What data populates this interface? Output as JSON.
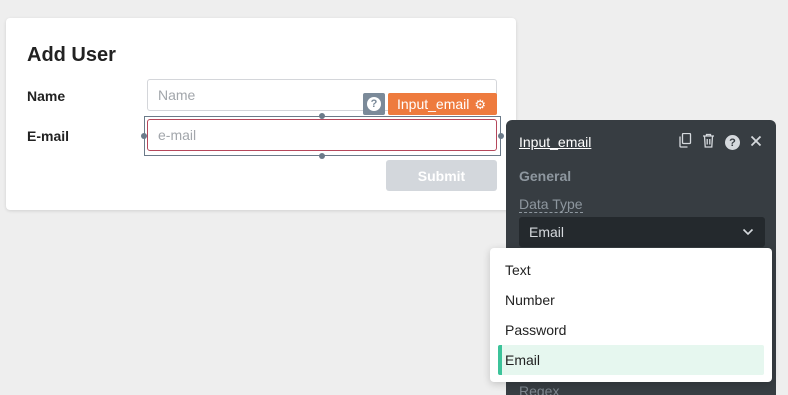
{
  "form": {
    "title": "Add User",
    "name_label": "Name",
    "name_placeholder": "Name",
    "email_label": "E-mail",
    "email_placeholder": "e-mail",
    "submit_label": "Submit"
  },
  "selection": {
    "help_glyph": "?",
    "component_name": "Input_email",
    "tag_icon": "gear-icon",
    "tag_color": "#ee7b3e"
  },
  "panel": {
    "title": "Input_email",
    "icons": [
      "copy-icon",
      "trash-icon",
      "help-icon",
      "close-icon"
    ],
    "help_glyph": "?",
    "section": "General",
    "data_type_label": "Data Type",
    "data_type_value": "Email",
    "next_label": "Regex"
  },
  "dropdown": {
    "options": [
      "Text",
      "Number",
      "Password",
      "Email"
    ],
    "selected": "Email",
    "accent": "#3cc39a"
  }
}
